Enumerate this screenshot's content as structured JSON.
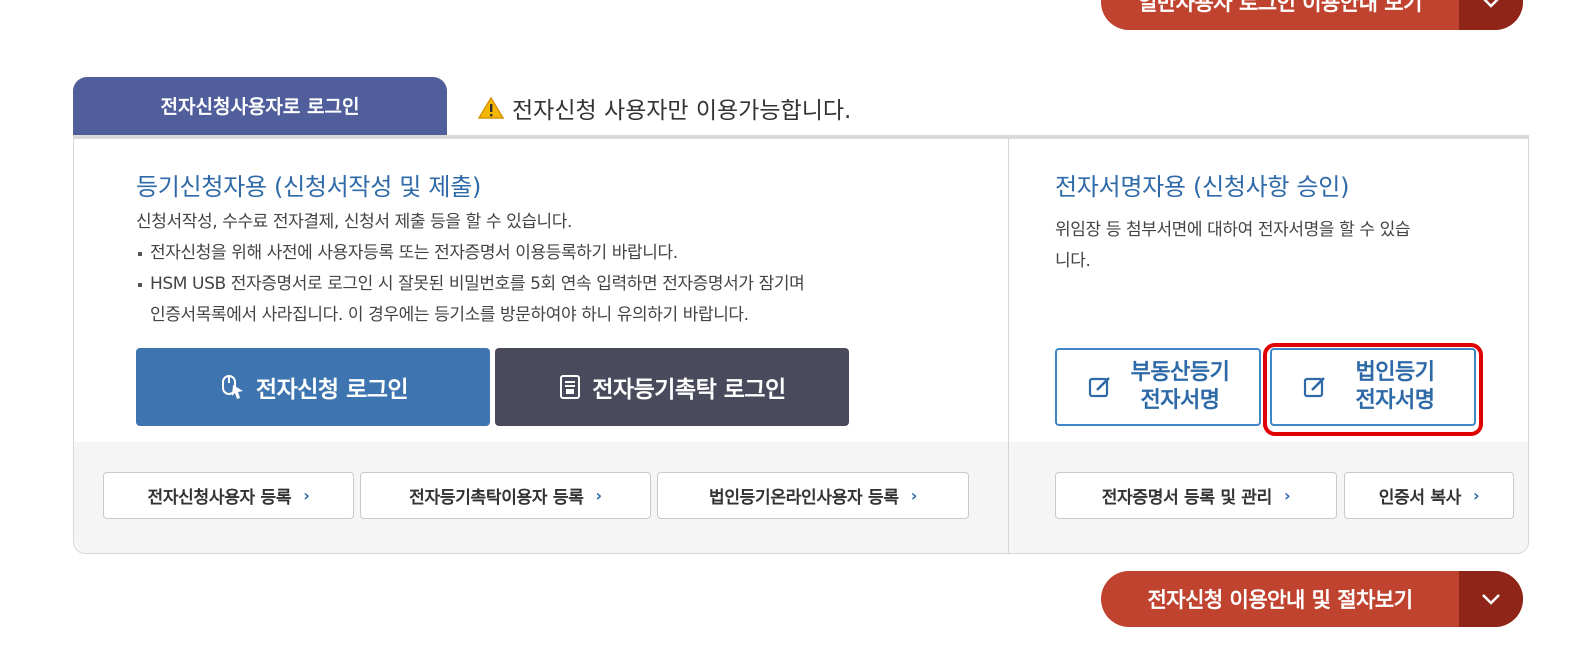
{
  "top_pill": {
    "label": "일반사용자 로그인 이용안내 보기"
  },
  "tab": {
    "label": "전자신청사용자로 로그인",
    "note": "전자신청 사용자만 이용가능합니다."
  },
  "left": {
    "title": "등기신청자용 (신청서작성 및 제출)",
    "line1": "신청서작성, 수수료 전자결제, 신청서 제출 등을 할 수 있습니다.",
    "bullet1": "전자신청을 위해 사전에 사용자등록 또는 전자증명서 이용등록하기 바랍니다.",
    "bullet2a": "HSM USB 전자증명서로 로그인 시 잘못된 비밀번호를 5회 연속 입력하면 전자증명서가 잠기며",
    "bullet2b": "인증서목록에서 사라집니다. 이 경우에는 등기소를 방문하여야 하니 유의하기 바랍니다.",
    "btn_login": "전자신청 로그인",
    "btn_trust": "전자등기촉탁 로그인",
    "links": [
      "전자신청사용자 등록",
      "전자등기촉탁이용자 등록",
      "법인등기온라인사용자 등록"
    ]
  },
  "right": {
    "title": "전자서명자용 (신청사항 승인)",
    "line1": "위임장 등 첨부서면에 대하여 전자서명을 할 수 있습",
    "line2": "니다.",
    "sign_realestate": [
      "부동산등기",
      "전자서명"
    ],
    "sign_corp": [
      "법인등기",
      "전자서명"
    ],
    "links": [
      "전자증명서 등록 및 관리",
      "인증서 복사"
    ]
  },
  "bottom_pill": {
    "label": "전자신청 이용안내 및 절차보기"
  },
  "colors": {
    "accent_red": "#c0432f",
    "tab_blue": "#505f9c",
    "btn_blue": "#3e75b0",
    "btn_dark": "#4a4a5d",
    "link_blue": "#2f6aa8",
    "highlight": "#e00000"
  }
}
